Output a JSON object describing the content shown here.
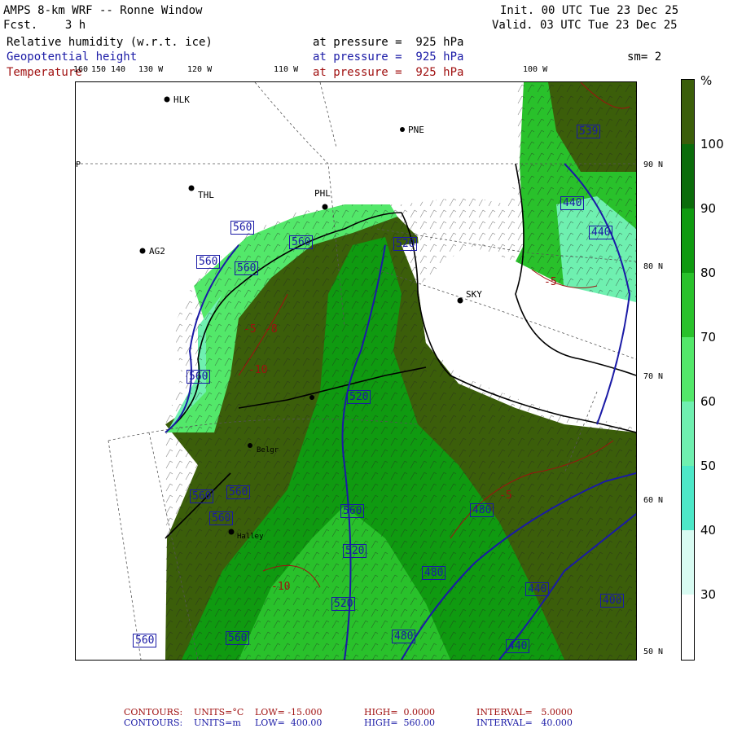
{
  "header": {
    "title": "AMPS 8-km WRF -- Ronne Window",
    "fcst": "Fcst.    3 h",
    "init": "Init. 00 UTC Tue 23 Dec 25",
    "valid": "Valid. 03 UTC Tue 23 Dec 25",
    "fields": [
      {
        "name": "Relative humidity (w.r.t. ice)",
        "level": "at pressure =  925 hPa",
        "color": "#000000"
      },
      {
        "name": "Geopotential height",
        "level": "at pressure =  925 hPa",
        "color": "#1a1aa6"
      },
      {
        "name": "Temperature",
        "level": "at pressure =  925 hPa",
        "color": "#a01010"
      }
    ],
    "sm": "sm= 2"
  },
  "lon_labels": [
    "160",
    "150",
    "140",
    "130 W",
    "120 W",
    "110 W",
    "100 W"
  ],
  "lat_labels": [
    "90 N",
    "80 N",
    "70 N",
    "60 N",
    "50 N"
  ],
  "stations": [
    "HLK",
    "PNE",
    "THL",
    "PHL",
    "AG2",
    "SKY",
    "Belgr",
    "Halley"
  ],
  "stations_fragment": "GP",
  "contour_labels": {
    "height": [
      "560",
      "560",
      "560",
      "560",
      "520",
      "560",
      "560",
      "520",
      "440",
      "440",
      "560",
      "520",
      "480",
      "480",
      "440",
      "400",
      "520",
      "480",
      "560",
      "560",
      "440",
      "560",
      "539",
      "560"
    ],
    "temp": [
      "-5",
      "-10",
      "-8",
      "-5",
      "-10",
      "-5"
    ]
  },
  "colorbar": {
    "unit": "%",
    "ticks": [
      "100",
      "90",
      "80",
      "70",
      "60",
      "50",
      "40",
      "30"
    ],
    "colors": [
      "#3b5e0a",
      "#0b6c0b",
      "#0f9a10",
      "#29c12b",
      "#53e86a",
      "#6ff0b0",
      "#4de8c8",
      "#d8fbf2",
      "#ffffff"
    ]
  },
  "footer": {
    "line1": {
      "label": "CONTOURS:",
      "units": "UNITS=°C",
      "low": "LOW= -15.000",
      "high": "HIGH=  0.0000",
      "interval": "INTERVAL=   5.0000",
      "color": "#a01010"
    },
    "line2": {
      "label": "CONTOURS:",
      "units": "UNITS=m",
      "low": "LOW=  400.00",
      "high": "HIGH=  560.00",
      "interval": "INTERVAL=   40.000",
      "color": "#1a1aa6"
    }
  }
}
